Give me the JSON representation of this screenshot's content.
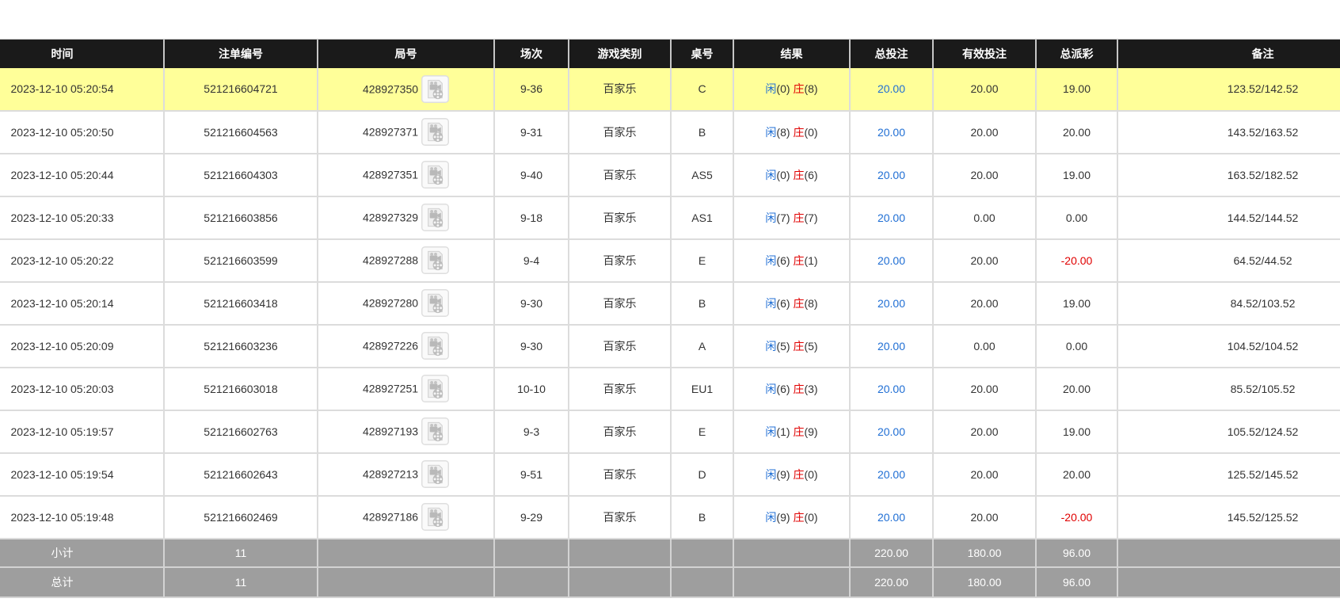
{
  "colors": {
    "header_bg": "#1a1a1a",
    "highlight_row": "#ffff99",
    "footer_bg": "#9e9e9e",
    "player": "#1f6ed4",
    "banker": "#e00000",
    "total_bet": "#1f6ed4",
    "negative": "#e00000"
  },
  "icons": {
    "round_replay": "video-replay-icon"
  },
  "columns": [
    "时间",
    "注单编号",
    "局号",
    "场次",
    "游戏类别",
    "桌号",
    "结果",
    "总投注",
    "有效投注",
    "总派彩",
    "备注"
  ],
  "result_labels": {
    "player": "闲",
    "banker": "庄"
  },
  "rows": [
    {
      "time": "2023-12-10 05:20:54",
      "bet_id": "521216604721",
      "round": "428927350",
      "session": "9-36",
      "game": "百家乐",
      "table": "C",
      "player_score": "(0)",
      "banker_score": "(8)",
      "total_bet": "20.00",
      "valid_bet": "20.00",
      "payout": "19.00",
      "remark": "123.52/142.52",
      "highlighted": true
    },
    {
      "time": "2023-12-10 05:20:50",
      "bet_id": "521216604563",
      "round": "428927371",
      "session": "9-31",
      "game": "百家乐",
      "table": "B",
      "player_score": "(8)",
      "banker_score": "(0)",
      "total_bet": "20.00",
      "valid_bet": "20.00",
      "payout": "20.00",
      "remark": "143.52/163.52"
    },
    {
      "time": "2023-12-10 05:20:44",
      "bet_id": "521216604303",
      "round": "428927351",
      "session": "9-40",
      "game": "百家乐",
      "table": "AS5",
      "player_score": "(0)",
      "banker_score": "(6)",
      "total_bet": "20.00",
      "valid_bet": "20.00",
      "payout": "19.00",
      "remark": "163.52/182.52"
    },
    {
      "time": "2023-12-10 05:20:33",
      "bet_id": "521216603856",
      "round": "428927329",
      "session": "9-18",
      "game": "百家乐",
      "table": "AS1",
      "player_score": "(7)",
      "banker_score": "(7)",
      "total_bet": "20.00",
      "valid_bet": "0.00",
      "payout": "0.00",
      "remark": "144.52/144.52"
    },
    {
      "time": "2023-12-10 05:20:22",
      "bet_id": "521216603599",
      "round": "428927288",
      "session": "9-4",
      "game": "百家乐",
      "table": "E",
      "player_score": "(6)",
      "banker_score": "(1)",
      "total_bet": "20.00",
      "valid_bet": "20.00",
      "payout": "-20.00",
      "remark": "64.52/44.52"
    },
    {
      "time": "2023-12-10 05:20:14",
      "bet_id": "521216603418",
      "round": "428927280",
      "session": "9-30",
      "game": "百家乐",
      "table": "B",
      "player_score": "(6)",
      "banker_score": "(8)",
      "total_bet": "20.00",
      "valid_bet": "20.00",
      "payout": "19.00",
      "remark": "84.52/103.52"
    },
    {
      "time": "2023-12-10 05:20:09",
      "bet_id": "521216603236",
      "round": "428927226",
      "session": "9-30",
      "game": "百家乐",
      "table": "A",
      "player_score": "(5)",
      "banker_score": "(5)",
      "total_bet": "20.00",
      "valid_bet": "0.00",
      "payout": "0.00",
      "remark": "104.52/104.52"
    },
    {
      "time": "2023-12-10 05:20:03",
      "bet_id": "521216603018",
      "round": "428927251",
      "session": "10-10",
      "game": "百家乐",
      "table": "EU1",
      "player_score": "(6)",
      "banker_score": "(3)",
      "total_bet": "20.00",
      "valid_bet": "20.00",
      "payout": "20.00",
      "remark": "85.52/105.52"
    },
    {
      "time": "2023-12-10 05:19:57",
      "bet_id": "521216602763",
      "round": "428927193",
      "session": "9-3",
      "game": "百家乐",
      "table": "E",
      "player_score": "(1)",
      "banker_score": "(9)",
      "total_bet": "20.00",
      "valid_bet": "20.00",
      "payout": "19.00",
      "remark": "105.52/124.52"
    },
    {
      "time": "2023-12-10 05:19:54",
      "bet_id": "521216602643",
      "round": "428927213",
      "session": "9-51",
      "game": "百家乐",
      "table": "D",
      "player_score": "(9)",
      "banker_score": "(0)",
      "total_bet": "20.00",
      "valid_bet": "20.00",
      "payout": "20.00",
      "remark": "125.52/145.52"
    },
    {
      "time": "2023-12-10 05:19:48",
      "bet_id": "521216602469",
      "round": "428927186",
      "session": "9-29",
      "game": "百家乐",
      "table": "B",
      "player_score": "(9)",
      "banker_score": "(0)",
      "total_bet": "20.00",
      "valid_bet": "20.00",
      "payout": "-20.00",
      "remark": "145.52/125.52"
    }
  ],
  "footer": [
    {
      "label": "小计",
      "count": "11",
      "total_bet": "220.00",
      "valid_bet": "180.00",
      "payout": "96.00"
    },
    {
      "label": "总计",
      "count": "11",
      "total_bet": "220.00",
      "valid_bet": "180.00",
      "payout": "96.00"
    }
  ]
}
